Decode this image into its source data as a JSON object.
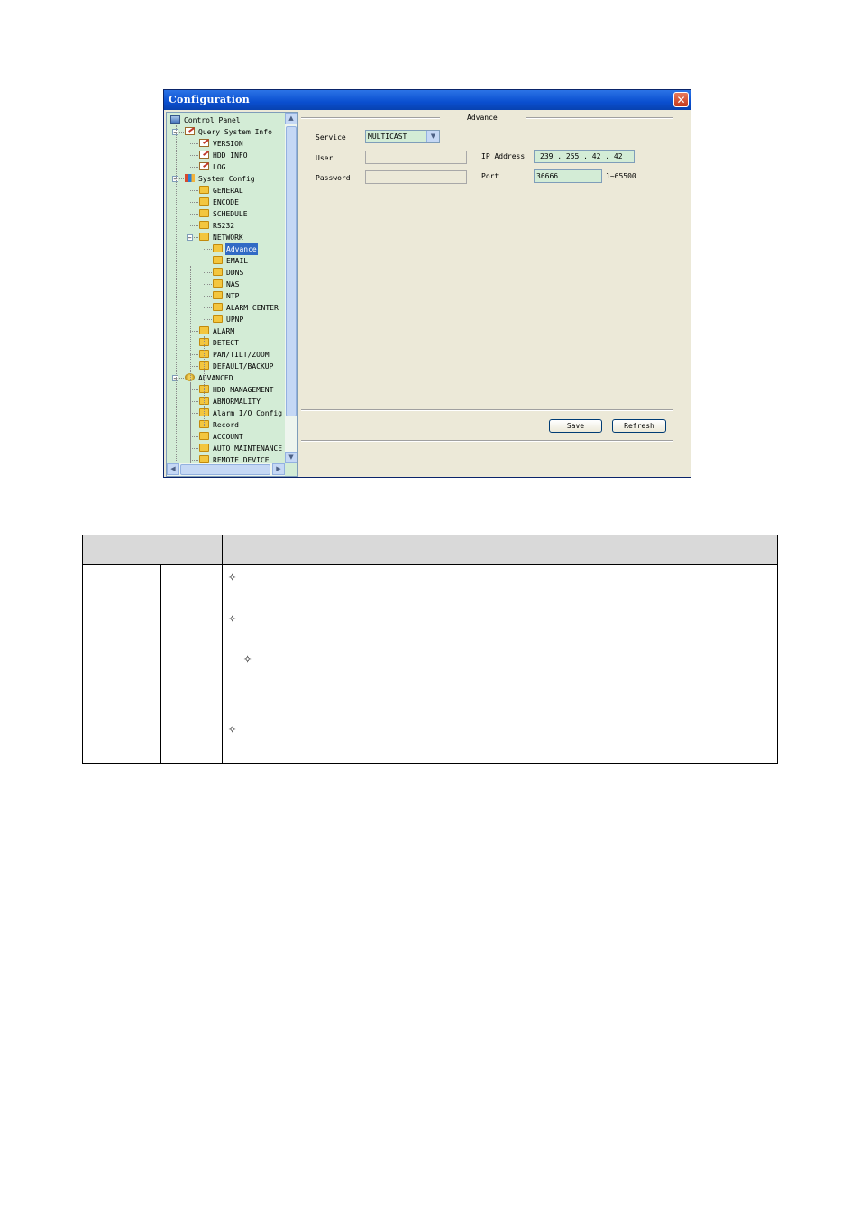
{
  "window": {
    "title": "Configuration",
    "close_glyph": "✕"
  },
  "tree": {
    "items": [
      {
        "label": "Control Panel",
        "icon": "control-panel-icon"
      },
      {
        "label": "Query System Info",
        "icon": "document-icon"
      },
      {
        "label": "VERSION",
        "icon": "document-icon"
      },
      {
        "label": "HDD INFO",
        "icon": "document-icon"
      },
      {
        "label": "LOG",
        "icon": "document-icon"
      },
      {
        "label": "System Config",
        "icon": "system-config-icon"
      },
      {
        "label": "GENERAL",
        "icon": "folder-icon"
      },
      {
        "label": "ENCODE",
        "icon": "folder-icon"
      },
      {
        "label": "SCHEDULE",
        "icon": "folder-icon"
      },
      {
        "label": "RS232",
        "icon": "folder-icon"
      },
      {
        "label": "NETWORK",
        "icon": "folder-icon"
      },
      {
        "label": "Advance",
        "icon": "open-folder-icon"
      },
      {
        "label": "EMAIL",
        "icon": "folder-icon"
      },
      {
        "label": "DDNS",
        "icon": "folder-icon"
      },
      {
        "label": "NAS",
        "icon": "folder-icon"
      },
      {
        "label": "NTP",
        "icon": "folder-icon"
      },
      {
        "label": "ALARM CENTER",
        "icon": "folder-icon"
      },
      {
        "label": "UPNP",
        "icon": "folder-icon"
      },
      {
        "label": "ALARM",
        "icon": "folder-icon"
      },
      {
        "label": "DETECT",
        "icon": "folder-icon"
      },
      {
        "label": "PAN/TILT/ZOOM",
        "icon": "folder-icon"
      },
      {
        "label": "DEFAULT/BACKUP",
        "icon": "folder-icon"
      },
      {
        "label": "ADVANCED",
        "icon": "gear-icon"
      },
      {
        "label": "HDD MANAGEMENT",
        "icon": "folder-icon"
      },
      {
        "label": "ABNORMALITY",
        "icon": "folder-icon"
      },
      {
        "label": "Alarm I/O Config",
        "icon": "folder-icon"
      },
      {
        "label": "Record",
        "icon": "folder-icon"
      },
      {
        "label": "ACCOUNT",
        "icon": "folder-icon"
      },
      {
        "label": "AUTO MAINTENANCE",
        "icon": "folder-icon"
      },
      {
        "label": "REMOTE DEVICE",
        "icon": "folder-icon"
      }
    ],
    "expander": "−",
    "scroll_up": "▲",
    "scroll_down": "▼",
    "scroll_left": "◀",
    "scroll_right": "▶"
  },
  "panel": {
    "section_title": "Advance",
    "service_label": "Service",
    "service_value": "MULTICAST",
    "service_arrow": "▼",
    "user_label": "User",
    "user_value": "",
    "password_label": "Password",
    "password_value": "",
    "ip_label": "IP Address",
    "ip_value": "239 . 255 . 42  . 42",
    "port_label": "Port",
    "port_value": "36666",
    "port_range": "1~65500",
    "save_label": "Save",
    "refresh_label": "Refresh"
  },
  "doc_table": {
    "bullet": "✧"
  }
}
